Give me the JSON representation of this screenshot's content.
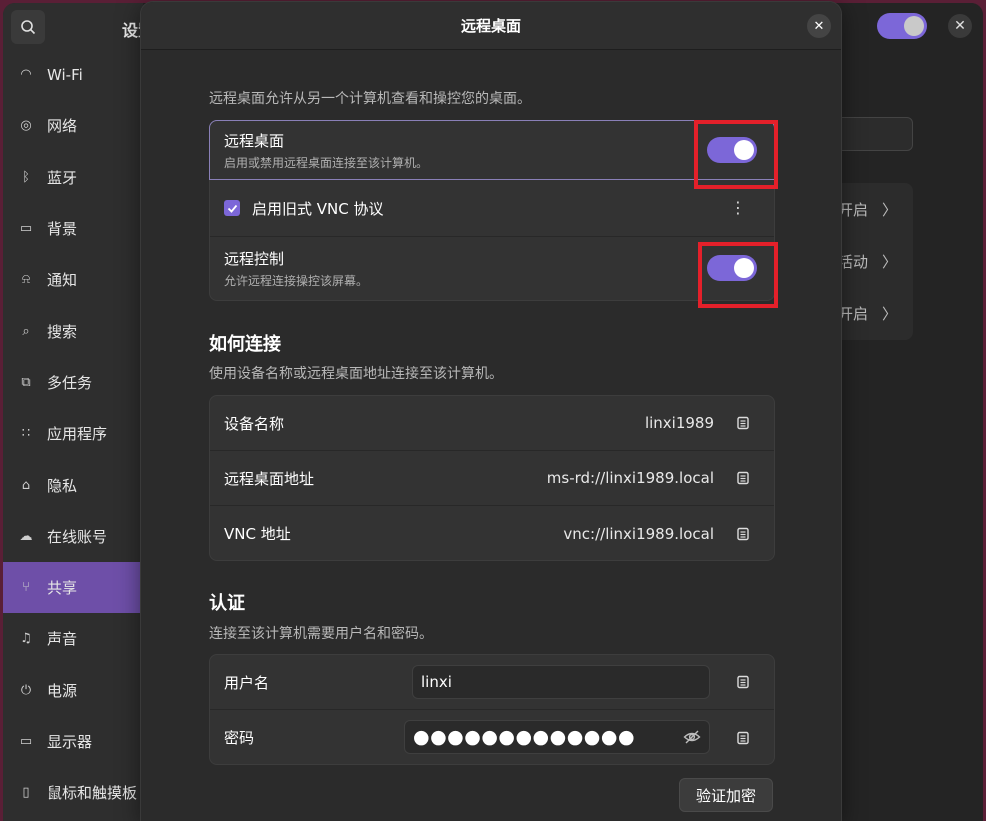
{
  "settings": {
    "title": "设置",
    "nav": [
      {
        "label": "Wi-Fi",
        "icon": "wifi-icon",
        "glyph": "◠"
      },
      {
        "label": "网络",
        "icon": "network-icon",
        "glyph": "◎"
      },
      {
        "label": "蓝牙",
        "icon": "bluetooth-icon",
        "glyph": "ᛒ"
      },
      {
        "label": "背景",
        "icon": "background-icon",
        "glyph": "▭"
      },
      {
        "label": "通知",
        "icon": "bell-icon",
        "glyph": "⍾"
      },
      {
        "label": "搜索",
        "icon": "search-icon",
        "glyph": "⌕"
      },
      {
        "label": "多任务",
        "icon": "multitasking-icon",
        "glyph": "⧉"
      },
      {
        "label": "应用程序",
        "icon": "apps-icon",
        "glyph": "∷"
      },
      {
        "label": "隐私",
        "icon": "lock-icon",
        "glyph": "⌂"
      },
      {
        "label": "在线账号",
        "icon": "cloud-icon",
        "glyph": "☁"
      },
      {
        "label": "共享",
        "icon": "share-icon",
        "glyph": "⑂",
        "active": true
      },
      {
        "label": "声音",
        "icon": "music-icon",
        "glyph": "♫"
      },
      {
        "label": "电源",
        "icon": "power-icon",
        "glyph": "⏻"
      },
      {
        "label": "显示器",
        "icon": "display-icon",
        "glyph": "▭"
      },
      {
        "label": "鼠标和触摸板",
        "icon": "mouse-icon",
        "glyph": "▯"
      }
    ],
    "background_rows": [
      "开启",
      "活动",
      "开启"
    ]
  },
  "dialog": {
    "title": "远程桌面",
    "intro": "远程桌面允许从另一个计算机查看和操控您的桌面。",
    "remote_desktop": {
      "title": "远程桌面",
      "subtitle": "启用或禁用远程桌面连接至该计算机。",
      "enabled": true
    },
    "legacy_vnc": {
      "label": "启用旧式 VNC 协议",
      "checked": true
    },
    "remote_control": {
      "title": "远程控制",
      "subtitle": "允许远程连接操控该屏幕。",
      "enabled": true
    },
    "how_to_connect": {
      "title": "如何连接",
      "desc": "使用设备名称或远程桌面地址连接至该计算机。",
      "rows": [
        {
          "label": "设备名称",
          "value": "linxi1989"
        },
        {
          "label": "远程桌面地址",
          "value": "ms-rd://linxi1989.local"
        },
        {
          "label": "VNC 地址",
          "value": "vnc://linxi1989.local"
        }
      ]
    },
    "auth": {
      "title": "认证",
      "desc": "连接至该计算机需要用户名和密码。",
      "username_label": "用户名",
      "username_value": "linxi",
      "password_label": "密码",
      "password_value": "●●●●●●●●●●●●●",
      "verify_label": "验证加密"
    }
  },
  "colors": {
    "accent": "#7c67d8",
    "highlight": "#e4202a",
    "sidebar_active": "#6e4fa8"
  }
}
